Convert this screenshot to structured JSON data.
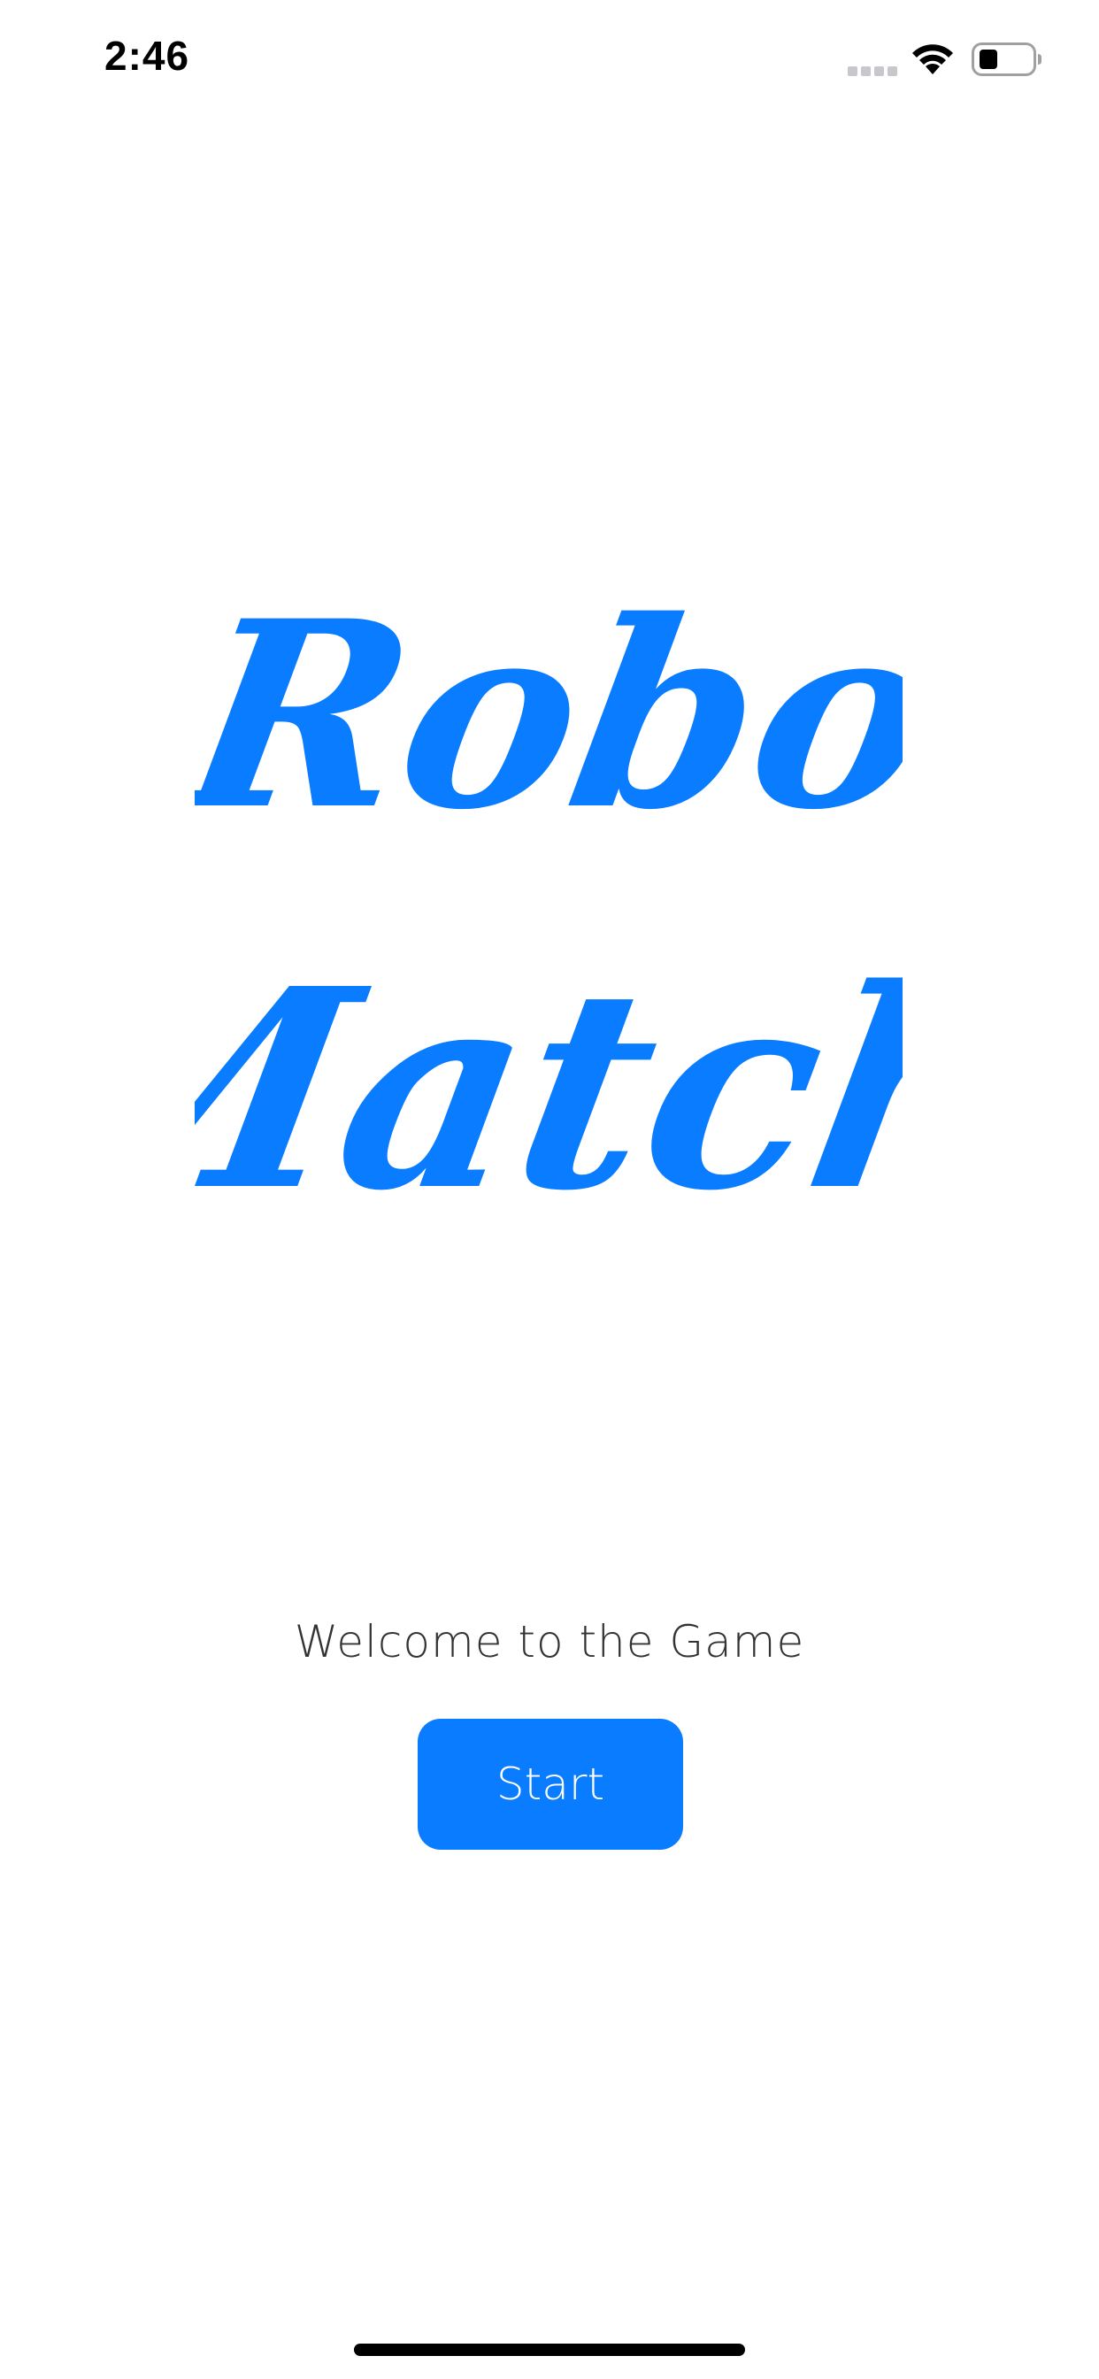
{
  "status_bar": {
    "time": "2:46",
    "icons": [
      "signal-icon",
      "wifi-icon",
      "battery-icon"
    ]
  },
  "title": {
    "line1": "Robo",
    "line2": "Match",
    "color": "#0a7cff"
  },
  "welcome_text": "Welcome to the Game",
  "start_button": {
    "label": "Start",
    "color": "#0a7cff"
  }
}
